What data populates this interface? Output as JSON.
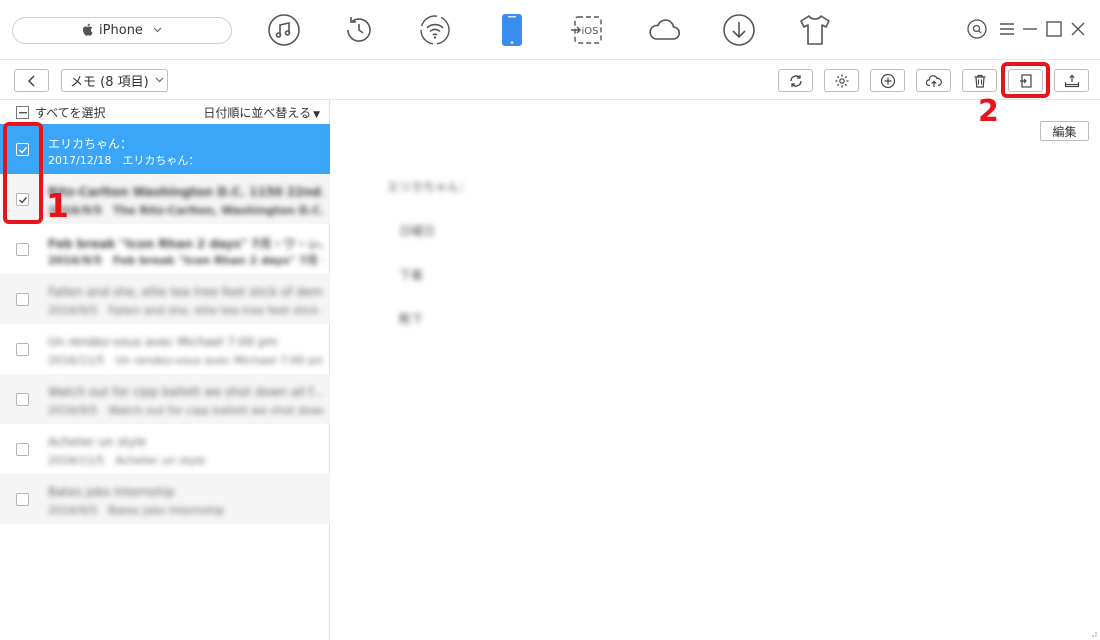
{
  "device": {
    "name": "iPhone"
  },
  "nav_icons": [
    "music-icon",
    "history-icon",
    "wifi-sync-icon",
    "iphone-icon",
    "to-ios-icon",
    "cloud-icon",
    "download-icon",
    "tshirt-icon"
  ],
  "nav_ios_label": "iOS",
  "toolbar": {
    "category": "メモ (8 項目)"
  },
  "list": {
    "select_all": "すべてを選択",
    "sort": "日付順に並べ替える",
    "rows": [
      {
        "title": "エリカちゃん：",
        "subtitle": "2017/12/18　エリカちゃん：",
        "checked": true,
        "selected": true
      },
      {
        "title": "Ritz-Carlton Washington D.C. 1150 22nd...",
        "subtitle": "2016/9/5　The Ritz-Carlton, Washington D.C. 1150...",
        "checked": true,
        "selected": false
      },
      {
        "title": "Feb break \"Icon Rhan 2 days\" 7月・ワ・ぃ...",
        "subtitle": "2016/9/5　Feb break \"Icon Rhan 2 days\" 7月・ワ...",
        "checked": false,
        "selected": false
      },
      {
        "title": "Fallen and she, ellie tea tree feet stick of dem...",
        "subtitle": "2016/9/5　Fallen and she, ellie tea tree feet stick of...",
        "checked": false,
        "selected": false
      },
      {
        "title": "Un rendez-vous avec Michael 7:00 pm",
        "subtitle": "2016/11/5　Un rendez-vous avec Michael 7:00 pm",
        "checked": false,
        "selected": false
      },
      {
        "title": "Watch out for cipp ballott we shot down all f...",
        "subtitle": "2016/9/5　Watch out for cipp ballott we shot down all...",
        "checked": false,
        "selected": false
      },
      {
        "title": "Acheter un style",
        "subtitle": "2016/11/5　Acheter un style",
        "checked": false,
        "selected": false
      },
      {
        "title": "Bates jobs Internship",
        "subtitle": "2016/9/5　Bates jobs Internship",
        "checked": false,
        "selected": false
      }
    ]
  },
  "detail": {
    "edit": "編集",
    "lines": [
      "エリカちゃん：",
      "日曜日",
      "下着",
      "靴下"
    ]
  },
  "annotations": {
    "step1": "1",
    "step2": "2",
    "color": "#e8141a"
  },
  "colors": {
    "selected_row": "#3ba6f7",
    "accent_iphone": "#3a8ef2"
  }
}
